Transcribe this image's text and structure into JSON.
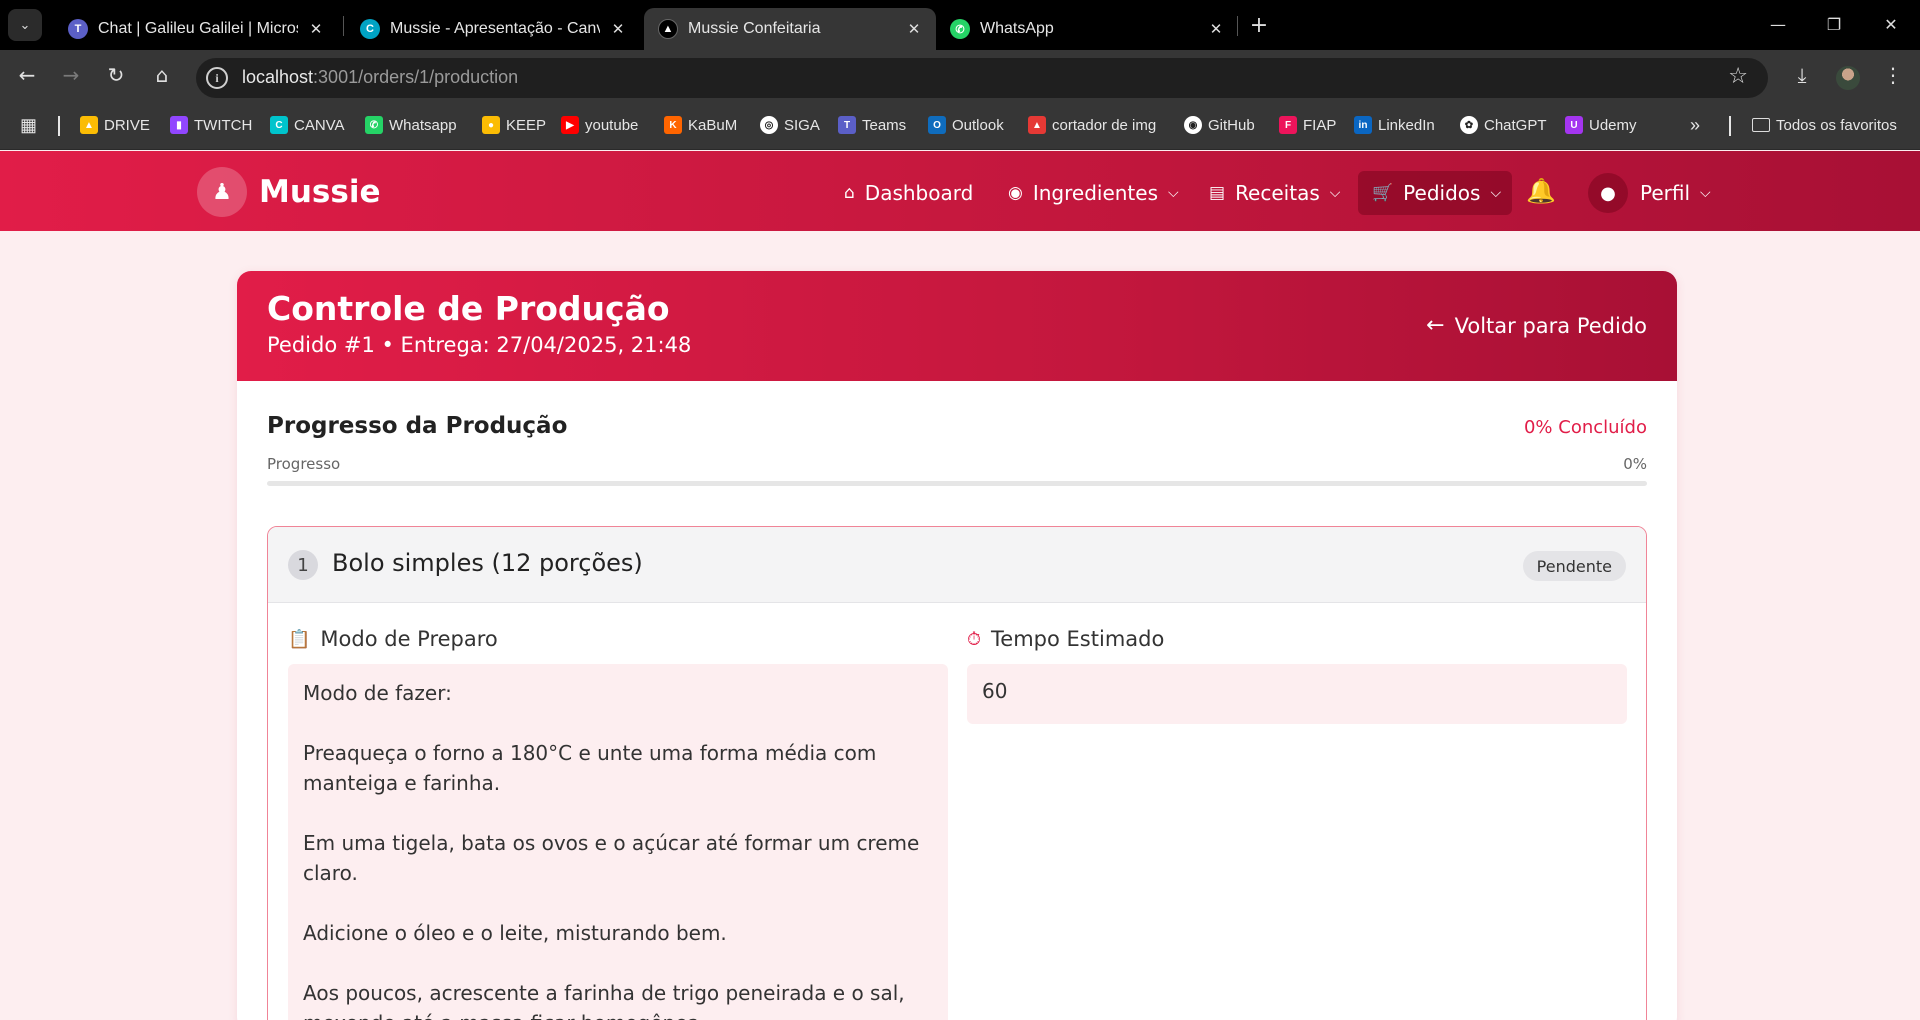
{
  "browser": {
    "tabs": [
      {
        "title": "Chat | Galileu Galilei | Microsoft",
        "icon": "teams-icon",
        "color": "#5b5fc7"
      },
      {
        "title": "Mussie - Apresentação - Canva",
        "icon": "canva-icon",
        "color": "#00c4cc"
      },
      {
        "title": "Mussie Confeitaria",
        "icon": "vercel-icon",
        "color": "#ffffff"
      },
      {
        "title": "WhatsApp",
        "icon": "whatsapp-icon",
        "color": "#25d366"
      }
    ],
    "active_tab_index": 2,
    "url_host": "localhost",
    "url_path": ":3001/orders/1/production",
    "bookmarks": [
      {
        "label": "DRIVE",
        "icon": "drive-icon",
        "color": "#fbbc04"
      },
      {
        "label": "TWITCH",
        "icon": "twitch-icon",
        "color": "#9146ff"
      },
      {
        "label": "CANVA",
        "icon": "canva-icon",
        "color": "#00c4cc"
      },
      {
        "label": "Whatsapp",
        "icon": "whatsapp-icon",
        "color": "#25d366"
      },
      {
        "label": "KEEP",
        "icon": "keep-icon",
        "color": "#fbbc04"
      },
      {
        "label": "youtube",
        "icon": "youtube-icon",
        "color": "#ff0000"
      },
      {
        "label": "KaBuM",
        "icon": "kabum-icon",
        "color": "#ff6500"
      },
      {
        "label": "SIGA",
        "icon": "globe-icon",
        "color": "#ffffff"
      },
      {
        "label": "Teams",
        "icon": "teams-icon",
        "color": "#5b5fc7"
      },
      {
        "label": "Outlook",
        "icon": "outlook-icon",
        "color": "#0f6cbd"
      },
      {
        "label": "cortador de img",
        "icon": "tree-icon",
        "color": "#e53935"
      },
      {
        "label": "GitHub",
        "icon": "github-icon",
        "color": "#ffffff"
      },
      {
        "label": "FIAP",
        "icon": "fiap-icon",
        "color": "#ed145b"
      },
      {
        "label": "LinkedIn",
        "icon": "linkedin-icon",
        "color": "#0a66c2"
      },
      {
        "label": "ChatGPT",
        "icon": "chatgpt-icon",
        "color": "#ffffff"
      },
      {
        "label": "Udemy",
        "icon": "udemy-icon",
        "color": "#a435f0"
      }
    ],
    "all_bookmarks_label": "Todos os favoritos"
  },
  "app": {
    "brand": "Mussie",
    "nav": {
      "dashboard": "Dashboard",
      "ingredientes": "Ingredientes",
      "receitas": "Receitas",
      "pedidos": "Pedidos",
      "perfil": "Perfil"
    },
    "accent_color": "#e11d48"
  },
  "page": {
    "title": "Controle de Produção",
    "subtitle": "Pedido #1 • Entrega: 27/04/2025, 21:48",
    "back_label": "Voltar para Pedido",
    "progress": {
      "title": "Progresso da Produção",
      "completed_label": "0% Concluído",
      "bar_label": "Progresso",
      "bar_value_label": "0%",
      "value": 0
    },
    "step": {
      "number": "1",
      "title": "Bolo simples (12 porções)",
      "status": "Pendente",
      "prep_label": "Modo de Preparo",
      "prep_text": "Modo de fazer:\n\nPreaqueça o forno a 180°C e unte uma forma média com manteiga e farinha.\n\nEm uma tigela, bata os ovos e o açúcar até formar um creme claro.\n\nAdicione o óleo e o leite, misturando bem.\n\nAos poucos, acrescente a farinha de trigo peneirada e o sal, mexendo até a massa ficar homogênea.",
      "time_label": "Tempo Estimado",
      "time_value": "60"
    }
  }
}
